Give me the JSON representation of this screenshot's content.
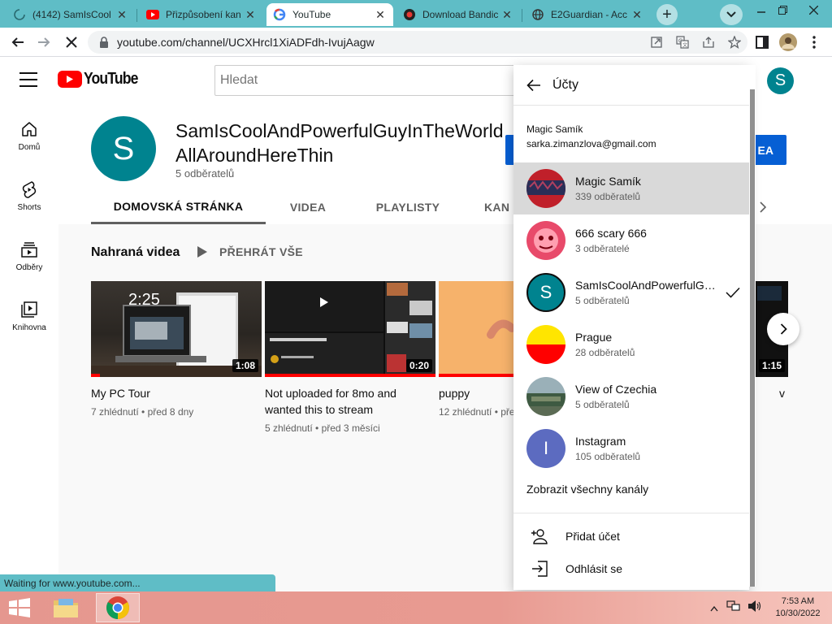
{
  "browser": {
    "tabs": [
      {
        "title": "(4142) SamIsCool",
        "favicon": "loading-spinner-icon"
      },
      {
        "title": "Přizpůsobení kan",
        "favicon": "youtube-icon"
      },
      {
        "title": "YouTube",
        "favicon": "google-icon",
        "active": true
      },
      {
        "title": "Download Bandic",
        "favicon": "bandicam-icon"
      },
      {
        "title": "E2Guardian - Acc",
        "favicon": "globe-icon"
      }
    ],
    "url": "youtube.com/channel/UCXHrcl1XiADFdh-IvujAagw",
    "status_text": "Waiting for www.youtube.com...",
    "accent_color": "#5fbdc6"
  },
  "youtube": {
    "logo_text": "YouTube",
    "search_placeholder": "Hledat",
    "avatar_letter": "S",
    "sidebar": [
      {
        "label": "Domů",
        "icon": "home-icon"
      },
      {
        "label": "Shorts",
        "icon": "shorts-icon"
      },
      {
        "label": "Odběry",
        "icon": "subscriptions-icon"
      },
      {
        "label": "Knihovna",
        "icon": "library-icon"
      }
    ],
    "channel": {
      "avatar_letter": "S",
      "name": "SamIsCoolAndPowerfulGuyInTheWorldAllAroundHereThin",
      "subscribers": "5 odběratelů",
      "customize_button": "EA",
      "tabs": [
        "DOMOVSKÁ STRÁNKA",
        "VIDEA",
        "PLAYLISTY",
        "KAN"
      ],
      "active_tab": "DOMOVSKÁ STRÁNKA"
    },
    "section": {
      "title": "Nahraná videa",
      "play_all": "PŘEHRÁT VŠE"
    },
    "videos": [
      {
        "title": "My PC Tour",
        "meta": "7 zhlédnutí • před 8 dny",
        "duration": "1:08",
        "thumb_overlay": "2:25",
        "watched": 0.05
      },
      {
        "title": "Not uploaded for 8mo and wanted this to stream",
        "meta": "5 zhlédnutí • před 3 měsíci",
        "duration": "0:20",
        "watched": 1.0
      },
      {
        "title": "puppy",
        "meta": "12 zhlédnutí • pře",
        "duration": "",
        "watched": 1.0
      },
      {
        "title": "v",
        "meta": "",
        "duration": "1:15",
        "watched": 0
      }
    ]
  },
  "accounts_menu": {
    "title": "Účty",
    "user_name": "Magic Samík",
    "user_email": "sarka.zimanzlova@gmail.com",
    "accounts": [
      {
        "name": "Magic Samík",
        "subs": "339 odběratelů",
        "selected": true,
        "checked": false,
        "avatar": "magic-samik-avatar-icon"
      },
      {
        "name": "666 scary 666",
        "subs": "3 odběratelé",
        "selected": false,
        "checked": false,
        "avatar": "scary-avatar-icon"
      },
      {
        "name": "SamIsCoolAndPowerfulGuyInTheWorldAllAroundHereThin",
        "subs": "5 odběratelů",
        "selected": false,
        "checked": true,
        "avatar": "letter-s-avatar-icon",
        "letter": "S"
      },
      {
        "name": "Prague",
        "subs": "28 odběratelů",
        "selected": false,
        "checked": false,
        "avatar": "prague-flag-avatar-icon"
      },
      {
        "name": "View of Czechia",
        "subs": "5 odběratelů",
        "selected": false,
        "checked": false,
        "avatar": "landscape-avatar-icon"
      },
      {
        "name": "Instagram",
        "subs": "105 odběratelů",
        "selected": false,
        "checked": false,
        "avatar": "letter-i-avatar-icon",
        "letter": "I"
      }
    ],
    "show_all": "Zobrazit všechny kanály",
    "add_account": "Přidat účet",
    "sign_out": "Odhlásit se"
  },
  "taskbar": {
    "time": "7:53 AM",
    "date": "10/30/2022"
  }
}
